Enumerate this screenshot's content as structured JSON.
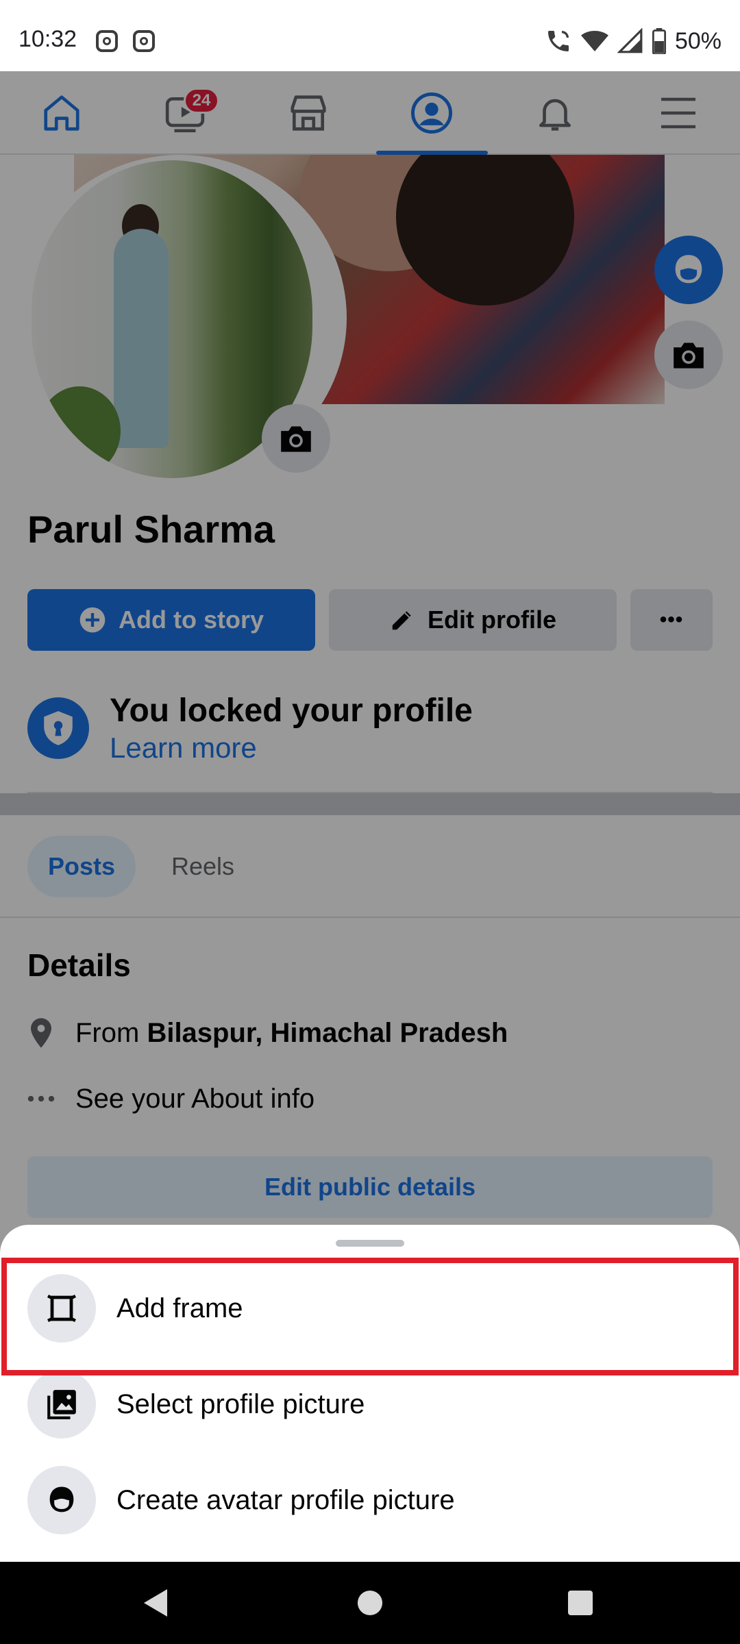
{
  "status_bar": {
    "time": "10:32",
    "notification_icons": [
      "instagram-icon",
      "instagram-icon"
    ],
    "right_icons": [
      "wifi-calling-icon",
      "wifi-icon",
      "signal-icon",
      "battery-icon"
    ],
    "battery": "50%"
  },
  "top_nav": {
    "items": [
      {
        "name": "home",
        "icon": "home-icon",
        "active": false
      },
      {
        "name": "video",
        "icon": "video-icon",
        "badge": "24",
        "active": false
      },
      {
        "name": "marketplace",
        "icon": "marketplace-icon",
        "active": false
      },
      {
        "name": "profile",
        "icon": "profile-icon",
        "active": true
      },
      {
        "name": "notifications",
        "icon": "bell-icon",
        "active": false
      },
      {
        "name": "menu",
        "icon": "menu-icon",
        "active": false
      }
    ],
    "accent_color": "#1b74e4"
  },
  "profile": {
    "name": "Parul Sharma",
    "add_to_story_label": "Add to story",
    "edit_profile_label": "Edit profile",
    "more_label": "•••"
  },
  "lock_notice": {
    "title": "You locked your profile",
    "link": "Learn more"
  },
  "tabs": [
    {
      "label": "Posts",
      "active": true
    },
    {
      "label": "Reels",
      "active": false
    }
  ],
  "details": {
    "title": "Details",
    "from_prefix": "From ",
    "from_place": "Bilaspur, Himachal Pradesh",
    "about_link": "See your About info",
    "edit_public_label": "Edit public details"
  },
  "bottom_sheet": {
    "items": [
      {
        "label": "Add frame",
        "icon": "frame-icon",
        "highlighted": true
      },
      {
        "label": "Select profile picture",
        "icon": "photo-album-icon",
        "highlighted": false
      },
      {
        "label": "Create avatar profile picture",
        "icon": "avatar-icon",
        "highlighted": false
      }
    ],
    "highlight_color": "#e01f2a"
  },
  "system_nav": {
    "buttons": [
      "back-icon",
      "home-circle-icon",
      "recents-icon"
    ]
  }
}
